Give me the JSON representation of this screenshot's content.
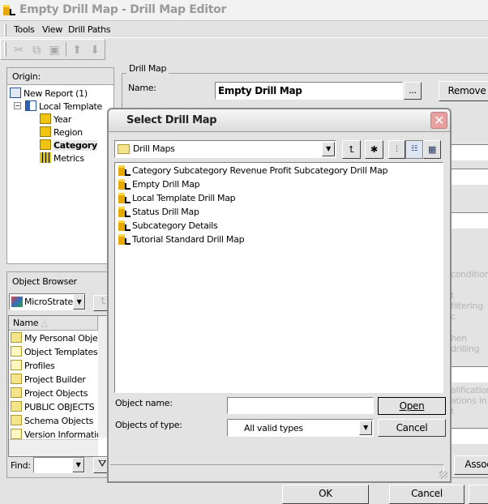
{
  "window": {
    "title": "Empty Drill Map - Drill Map Editor"
  },
  "menu": [
    "Tools",
    "View",
    "Drill Paths"
  ],
  "toolbar": {
    "icons": [
      "cut-icon",
      "copy-icon",
      "paste-icon",
      "move-up-icon",
      "move-down-icon"
    ]
  },
  "origin": {
    "header": "Origin:",
    "tree": [
      {
        "label": "New Report (1)",
        "icon": "report-grid-icon"
      },
      {
        "label": "Local Template",
        "icon": "template-icon"
      },
      {
        "label": "Year",
        "icon": "attribute-cube-icon"
      },
      {
        "label": "Region",
        "icon": "attribute-cube-icon"
      },
      {
        "label": "Category",
        "icon": "attribute-cube-icon",
        "selected": true
      },
      {
        "label": "Metrics",
        "icon": "metrics-icon"
      }
    ]
  },
  "object_browser": {
    "header": "Object Browser",
    "project": "MicroStrategy",
    "column": "Name",
    "items": [
      "My Personal Objects",
      "Object Templates",
      "Profiles",
      "Project Builder",
      "Project Objects",
      "PUBLIC OBJECTS",
      "Schema Objects",
      "Version Information"
    ],
    "find_label": "Find:"
  },
  "drill_map": {
    "group_label": "Drill Map",
    "name_label": "Name:",
    "name_value": "Empty Drill Map",
    "browse_label": "...",
    "remove_label": "Remove"
  },
  "background_text": [
    "conditions",
    "t filtering c",
    "hen drilling",
    "alifications",
    "ations in t",
    "Assoc"
  ],
  "dialog": {
    "title": "Select Drill Map",
    "folder": "Drill Maps",
    "items": [
      "Category Subcategory Revenue Profit Subcategory Drill Map",
      "Empty Drill Map",
      "Local Template Drill Map",
      "Status Drill Map",
      "Subcategory Details",
      "Tutorial Standard Drill Map"
    ],
    "object_name_label": "Object name:",
    "object_name_value": "",
    "objects_of_type_label": "Objects of type:",
    "objects_of_type_value": "All valid types",
    "open_label": "Open",
    "cancel_label": "Cancel"
  },
  "footer": {
    "ok_label": "OK",
    "cancel_label": "Cancel"
  }
}
